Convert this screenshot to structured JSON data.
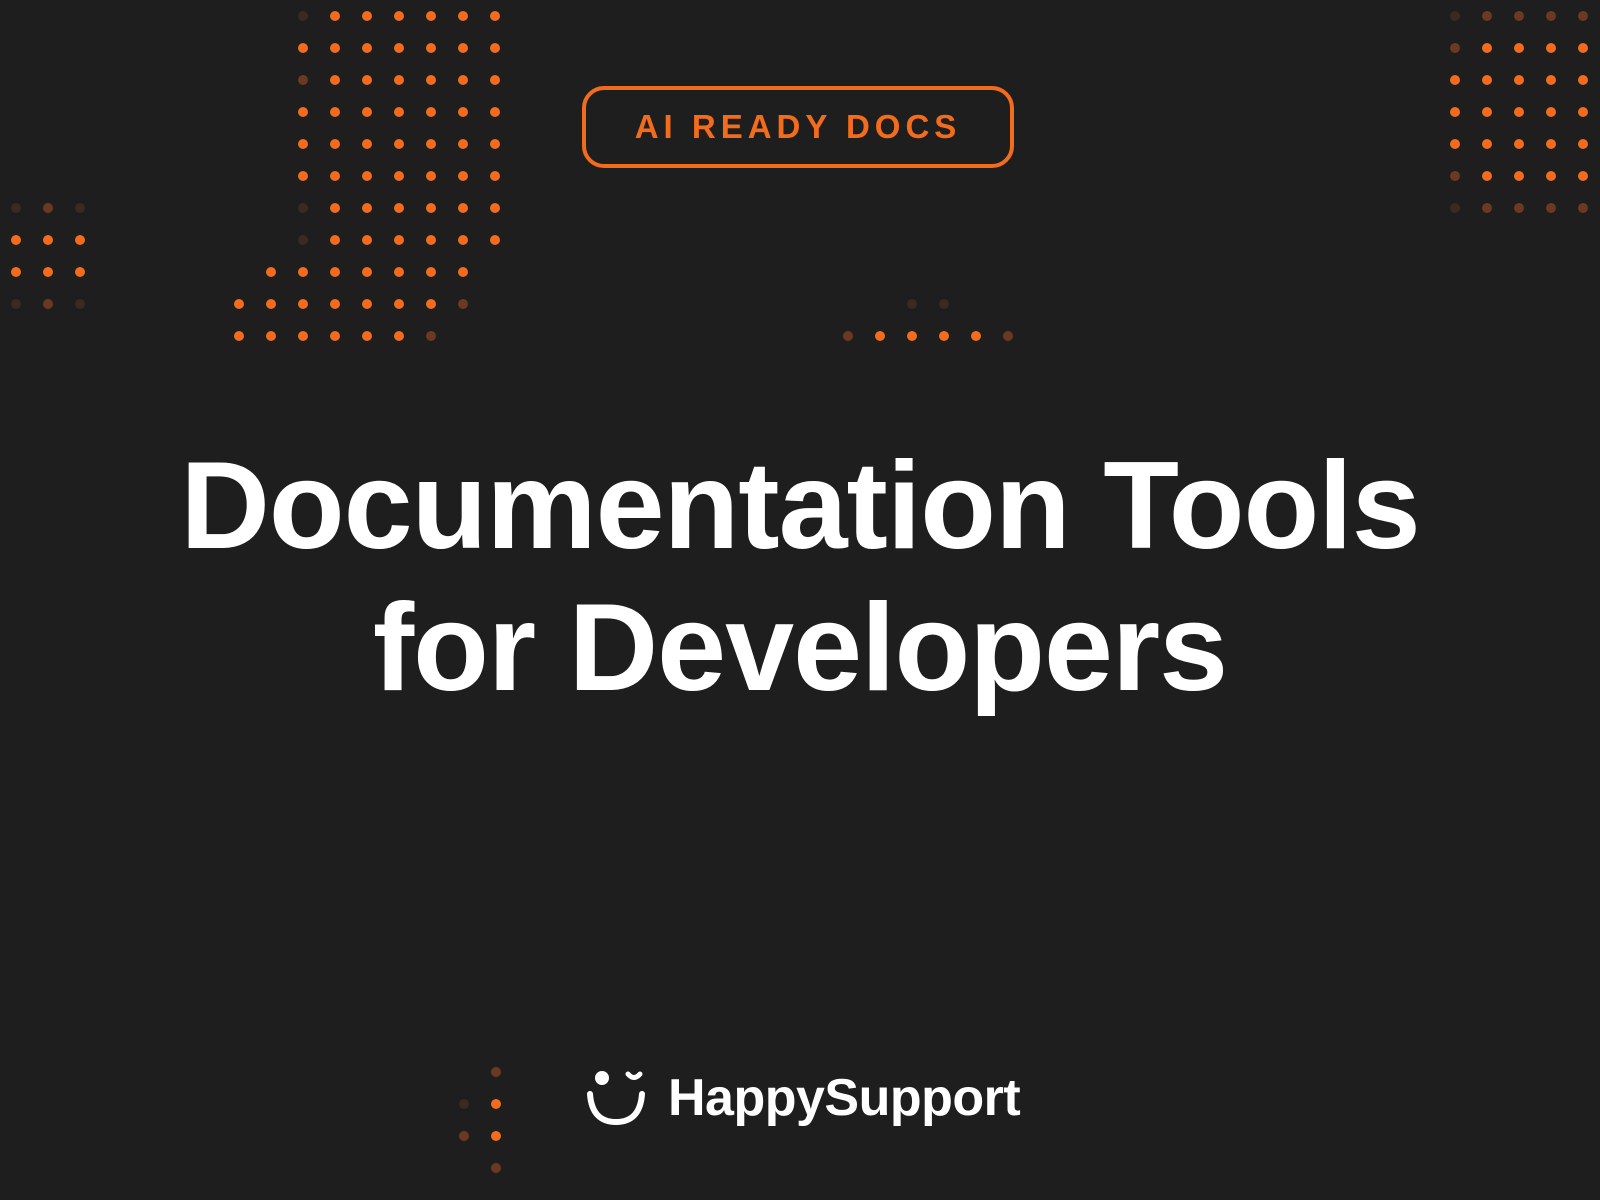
{
  "badge": {
    "label": "AI READY DOCS"
  },
  "headline": {
    "line1": "Documentation Tools",
    "line2": "for Developers"
  },
  "brand": {
    "name": "HappySupport",
    "logo_icon": "smiley-wink-icon"
  },
  "colors": {
    "background": "#1f1e1e",
    "accent": "#f36c1b",
    "text": "#ffffff"
  }
}
